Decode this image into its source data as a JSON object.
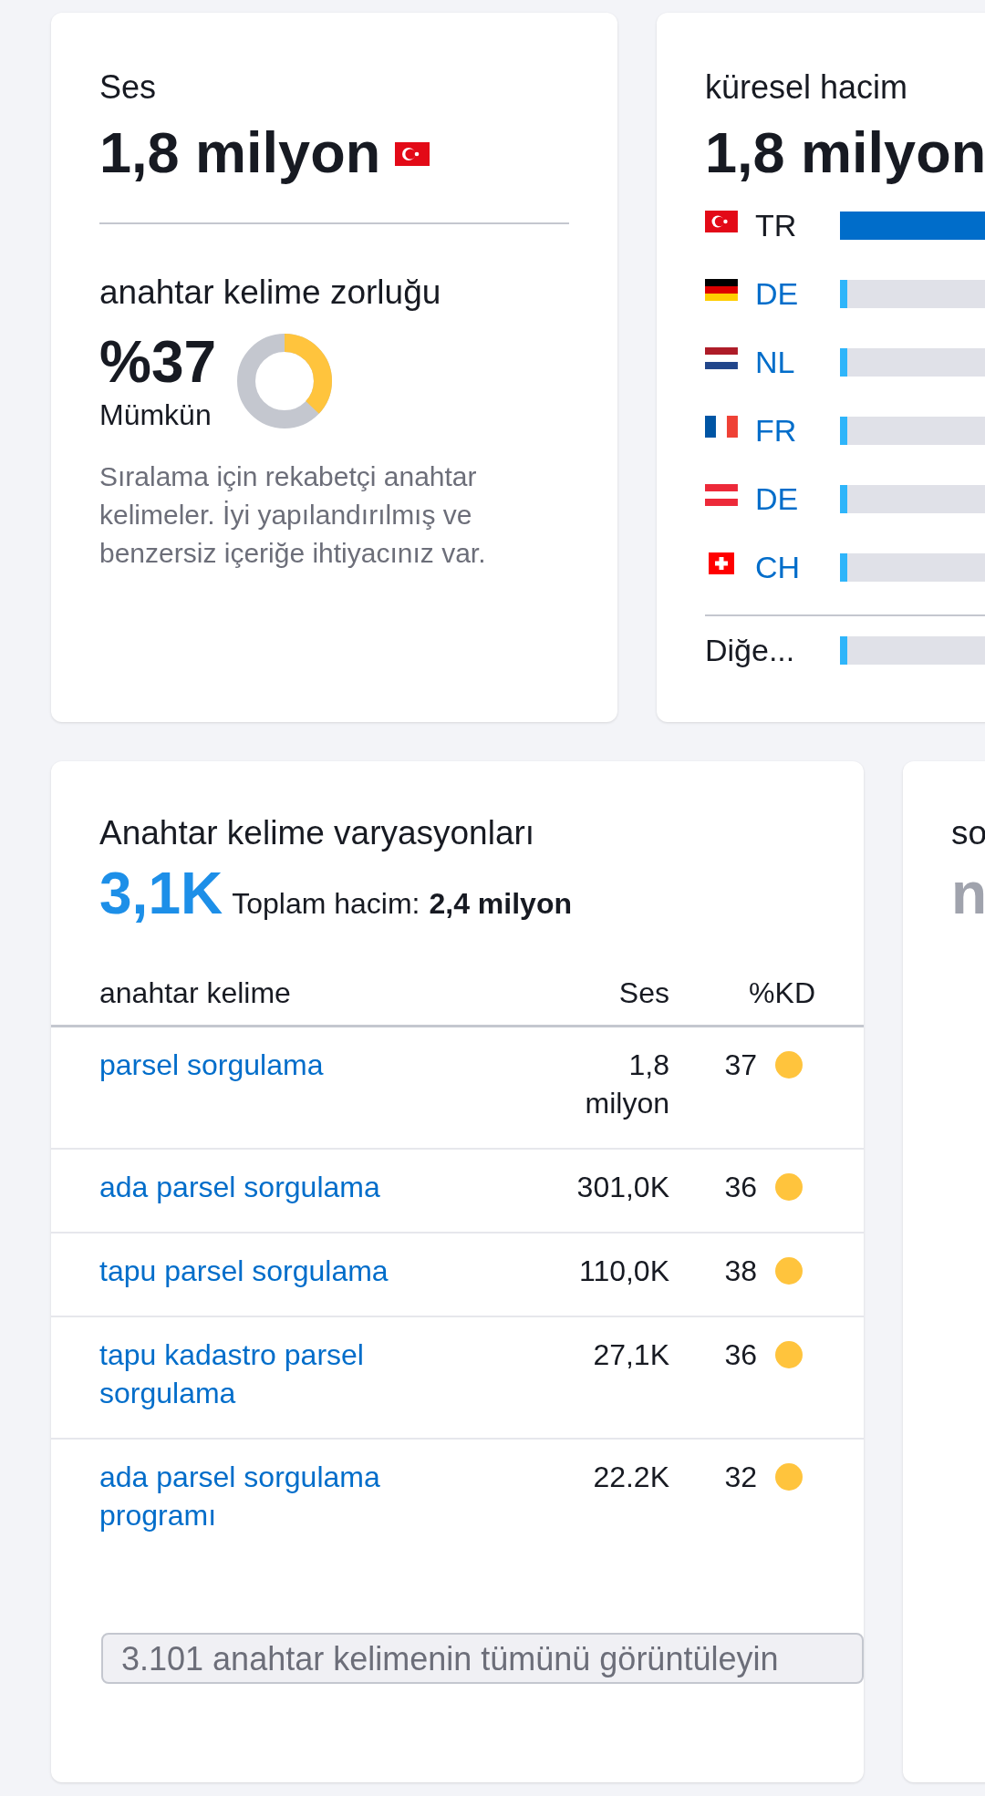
{
  "volume_card": {
    "label": "Ses",
    "value": "1,8 milyon"
  },
  "difficulty": {
    "label": "anahtar kelime zorluğu",
    "value": "%37",
    "rating": "Mümkün",
    "level": 0.37,
    "description": "Sıralama için rekabetçi anahtar kelimeler. İyi yapılandırılmış ve benzersiz içeriğe ihtiyacınız var."
  },
  "global_volume": {
    "label": "küresel hacim",
    "value": "1,8 milyon",
    "countries": [
      {
        "code": "TR",
        "kind": "tr",
        "selected": true,
        "level": 1
      },
      {
        "code": "DE",
        "kind": "de",
        "selected": false,
        "level": 0.02
      },
      {
        "code": "NL",
        "kind": "nl",
        "selected": false,
        "level": 0.02
      },
      {
        "code": "FR",
        "kind": "fr",
        "selected": false,
        "level": 0.02
      },
      {
        "code": "DE",
        "kind": "at",
        "selected": false,
        "level": 0.02
      },
      {
        "code": "CH",
        "kind": "ch",
        "selected": false,
        "level": 0.02
      }
    ],
    "other": {
      "label": "Diğe...",
      "level": 0.02
    }
  },
  "variations": {
    "title": "Anahtar kelime varyasyonları",
    "count": "3,1K",
    "total_label": "Toplam hacim:",
    "total_value": "2,4 milyon",
    "columns": [
      "anahtar kelime",
      "Ses",
      "%KD"
    ],
    "rows": [
      {
        "keyword": "parsel sorgulama",
        "volume": "1,8 milyon",
        "kd": "37"
      },
      {
        "keyword": "ada parsel sorgulama",
        "volume": "301,0K",
        "kd": "36"
      },
      {
        "keyword": "tapu parsel sorgulama",
        "volume": "110,0K",
        "kd": "38"
      },
      {
        "keyword": "tapu kadastro parsel sorgulama",
        "volume": "27,1K",
        "kd": "36"
      },
      {
        "keyword": "ada parsel sorgulama programı",
        "volume": "22.2K",
        "kd": "32"
      }
    ],
    "button": "3.101 anahtar kelimenin tümünü görüntüleyin"
  },
  "next_card": {
    "title": "so",
    "value": "n"
  }
}
